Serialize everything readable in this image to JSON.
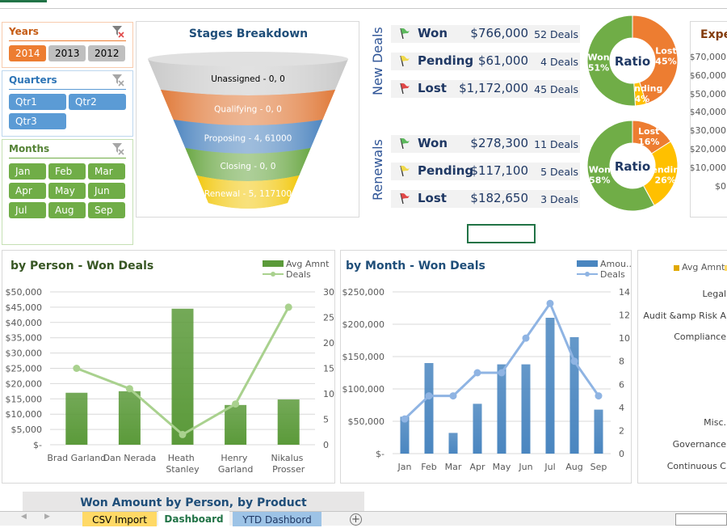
{
  "slicers": {
    "years": {
      "title": "Years",
      "items": [
        "2014",
        "2013",
        "2012"
      ],
      "selected": "2014"
    },
    "quarters": {
      "title": "Quarters",
      "items": [
        "Qtr1",
        "Qtr2",
        "Qtr3"
      ]
    },
    "months": {
      "title": "Months",
      "items": [
        "Jan",
        "Feb",
        "Mar",
        "Apr",
        "May",
        "Jun",
        "Jul",
        "Aug",
        "Sep"
      ]
    }
  },
  "funnel": {
    "title": "Stages Breakdown",
    "stages": [
      {
        "label": "Unassigned - 0, 0",
        "color": "#c9c9c9"
      },
      {
        "label": "Qualifying - 0, 0",
        "color": "#e07a3a"
      },
      {
        "label": "Proposing - 4, 61000",
        "color": "#4f86c0"
      },
      {
        "label": "Closing - 0, 0",
        "color": "#6aa744"
      },
      {
        "label": "Renewal - 5, 117100",
        "color": "#f2c80f"
      }
    ]
  },
  "new_deals": {
    "label": "New Deals",
    "rows": [
      {
        "status": "Won",
        "amount": "$766,000",
        "count": "52 Deals",
        "flag": "#5cb85c"
      },
      {
        "status": "Pending",
        "amount": "$61,000",
        "count": "4 Deals",
        "flag": "#f0d94a"
      },
      {
        "status": "Lost",
        "amount": "$1,172,000",
        "count": "45 Deals",
        "flag": "#e04848"
      }
    ],
    "ratio": {
      "title": "Ratio",
      "slices": [
        {
          "name": "Lost",
          "pct": 45,
          "label": "45%",
          "color": "#ed7d31"
        },
        {
          "name": "Pending",
          "pct": 4,
          "label": "4%",
          "color": "#ffc000"
        },
        {
          "name": "Won",
          "pct": 51,
          "label": "51%",
          "color": "#70ad47"
        }
      ]
    }
  },
  "renewals": {
    "label": "Renewals",
    "rows": [
      {
        "status": "Won",
        "amount": "$278,300",
        "count": "11 Deals",
        "flag": "#5cb85c"
      },
      {
        "status": "Pending",
        "amount": "$117,100",
        "count": "5 Deals",
        "flag": "#f0d94a"
      },
      {
        "status": "Lost",
        "amount": "$182,650",
        "count": "3 Deals",
        "flag": "#e04848"
      }
    ],
    "ratio": {
      "title": "Ratio",
      "slices": [
        {
          "name": "Lost",
          "pct": 16,
          "label": "16%",
          "color": "#ed7d31"
        },
        {
          "name": "Pending",
          "pct": 26,
          "label": "26%",
          "color": "#ffc000"
        },
        {
          "name": "Won",
          "pct": 58,
          "label": "58%",
          "color": "#70ad47"
        }
      ]
    }
  },
  "expenses": {
    "title": "Expe",
    "ticks": [
      "$70,000",
      "$60,000",
      "$50,000",
      "$40,000",
      "$30,000",
      "$20,000",
      "$10,000",
      "$0"
    ]
  },
  "category_panel": {
    "legend": "Avg Amnt",
    "categories": [
      "Legal",
      "Audit &amp Risk A",
      "Compliance",
      "Misc.",
      "Governance",
      "Continuous C"
    ]
  },
  "chart_data": [
    {
      "type": "bar",
      "title": "by Person - Won Deals",
      "categories": [
        "Brad Garland",
        "Dan Nerada",
        "Heath Stanley",
        "Henry Garland",
        "Nikalus Prosser"
      ],
      "series": [
        {
          "name": "Avg Amnt",
          "type": "bar",
          "axis": "left",
          "values": [
            17000,
            17500,
            44500,
            13000,
            14800
          ],
          "color": "#5b9a3a"
        },
        {
          "name": "Deals",
          "type": "line",
          "axis": "right",
          "values": [
            15,
            11,
            2,
            8,
            27
          ],
          "color": "#a9d18e"
        }
      ],
      "ylim": [
        0,
        50000
      ],
      "y_ticks": [
        "$-",
        "$5,000",
        "$10,000",
        "$15,000",
        "$20,000",
        "$25,000",
        "$30,000",
        "$35,000",
        "$40,000",
        "$45,000",
        "$50,000"
      ],
      "y2lim": [
        0,
        30
      ],
      "y2_ticks": [
        "0",
        "5",
        "10",
        "15",
        "20",
        "25",
        "30"
      ],
      "grid": true,
      "legend": "top-right"
    },
    {
      "type": "bar",
      "title": "by Month - Won Deals",
      "categories": [
        "Jan",
        "Feb",
        "Mar",
        "Apr",
        "May",
        "Jun",
        "Jul",
        "Aug",
        "Sep"
      ],
      "series": [
        {
          "name": "Amou...",
          "type": "bar",
          "axis": "left",
          "values": [
            57000,
            140000,
            32000,
            77000,
            138000,
            138000,
            210000,
            180000,
            68000
          ],
          "color": "#4a86c0"
        },
        {
          "name": "Deals",
          "type": "line",
          "axis": "right",
          "values": [
            3,
            5,
            5,
            7,
            7,
            10,
            13,
            8,
            5
          ],
          "color": "#8fb4e3"
        }
      ],
      "ylim": [
        0,
        250000
      ],
      "y_ticks": [
        "$-",
        "$50,000",
        "$100,000",
        "$150,000",
        "$200,000",
        "$250,000"
      ],
      "y2lim": [
        0,
        14
      ],
      "y2_ticks": [
        "0",
        "2",
        "4",
        "6",
        "8",
        "10",
        "12",
        "14"
      ],
      "grid": true,
      "legend": "top-right"
    }
  ],
  "bottom_section": {
    "title": "Won Amount by Person, by Product"
  },
  "sheet_tabs": [
    {
      "label": "CSV Import",
      "color": "#ffd966"
    },
    {
      "label": "Dashboard",
      "color": "#ffffff",
      "active": true
    },
    {
      "label": "YTD Dashbord",
      "color": "#9dc3e6"
    }
  ]
}
